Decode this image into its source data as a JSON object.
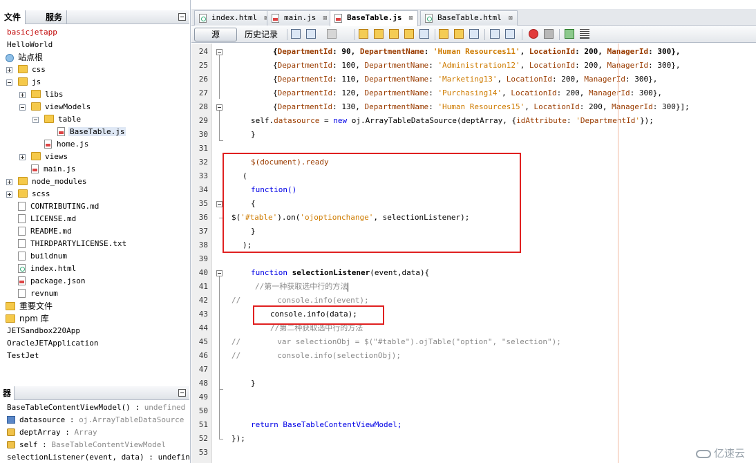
{
  "left_panel": {
    "tabs": [
      "文件",
      "服务"
    ],
    "tree": [
      {
        "label": "basicjetapp",
        "red": true
      },
      {
        "label": "HelloWorld"
      },
      {
        "label": "站点根",
        "cn": true
      },
      {
        "label": "css"
      },
      {
        "label": "js"
      },
      {
        "label": "libs"
      },
      {
        "label": "viewModels"
      },
      {
        "label": "table"
      },
      {
        "label": "BaseTable.js"
      },
      {
        "label": "home.js"
      },
      {
        "label": "views"
      },
      {
        "label": "main.js"
      },
      {
        "label": "node_modules"
      },
      {
        "label": "scss"
      },
      {
        "label": "CONTRIBUTING.md"
      },
      {
        "label": "LICENSE.md"
      },
      {
        "label": "README.md"
      },
      {
        "label": "THIRDPARTYLICENSE.txt"
      },
      {
        "label": "buildnum"
      },
      {
        "label": "index.html"
      },
      {
        "label": "package.json"
      },
      {
        "label": "revnum"
      },
      {
        "label": "重要文件",
        "cn": true
      },
      {
        "label": "npm 库",
        "cn": true
      },
      {
        "label": "JETSandbox220App"
      },
      {
        "label": "OracleJETApplication"
      },
      {
        "label": "TestJet"
      }
    ],
    "navigator_tab": "器",
    "navigator": [
      {
        "name": "BaseTableContentViewModel()",
        "type": "undefined"
      },
      {
        "name": "datasource",
        "type": "oj.ArrayTableDataSource"
      },
      {
        "name": "deptArray",
        "type": "Array"
      },
      {
        "name": "self",
        "type": "BaseTableContentViewModel"
      },
      {
        "name": "selectionListener(event, data)",
        "type": "undefined"
      }
    ]
  },
  "editor": {
    "tabs": [
      {
        "label": "index.html",
        "icon": "html-file-icon"
      },
      {
        "label": "main.js",
        "icon": "js-file-icon"
      },
      {
        "label": "BaseTable.js",
        "icon": "js-file-icon",
        "active": true
      },
      {
        "label": "BaseTable.html",
        "icon": "html-file-icon"
      }
    ],
    "close_glyph": "⊠",
    "toolbar": {
      "source": "源",
      "history": "历史记录"
    },
    "line_numbers": [
      24,
      25,
      26,
      27,
      28,
      29,
      30,
      31,
      32,
      33,
      34,
      35,
      36,
      37,
      38,
      39,
      40,
      41,
      42,
      43,
      44,
      45,
      46,
      47,
      48,
      49,
      50,
      51,
      52,
      53
    ],
    "code": {
      "l24": "{DepartmentId: 90, DepartmentName: 'Human Resources11', LocationId: 200, ManagerId: 300},",
      "l25": "{DepartmentId: 100, DepartmentName: 'Administration12', LocationId: 200, ManagerId: 300},",
      "l26": "{DepartmentId: 110, DepartmentName: 'Marketing13', LocationId: 200, ManagerId: 300},",
      "l27": "{DepartmentId: 120, DepartmentName: 'Purchasing14', LocationId: 200, ManagerId: 300},",
      "l28": "{DepartmentId: 130, DepartmentName: 'Human Resources15', LocationId: 200, ManagerId: 300}];",
      "l29": "self.datasource = new oj.ArrayTableDataSource(deptArray, {idAttribute: 'DepartmentId'});",
      "l30": "}",
      "l32": "$(document).ready",
      "l33": "(",
      "l34": "function()",
      "l35": "{",
      "l36": "$('#table').on('ojoptionchange', selectionListener);",
      "l37": "}",
      "l38": ");",
      "l40": "function selectionListener(event,data){",
      "l41": "//第一种获取选中行的方法",
      "l42": "//        console.info(event);",
      "l43": "console.info(data);",
      "l44": "//第二种获取选中行的方法",
      "l45": "//        var selectionObj = $(\"#table\").ojTable(\"option\", \"selection\");",
      "l46": "//        console.info(selectionObj);",
      "l48": "}",
      "l51": "return BaseTableContentViewModel;",
      "l52": "});"
    }
  },
  "watermark": "亿速云",
  "colors": {
    "keyword": "#0000e6",
    "property": "#9a3c00",
    "string": "#ce7b00",
    "comment": "#8a8a8a",
    "highlight_box": "#e02020"
  }
}
